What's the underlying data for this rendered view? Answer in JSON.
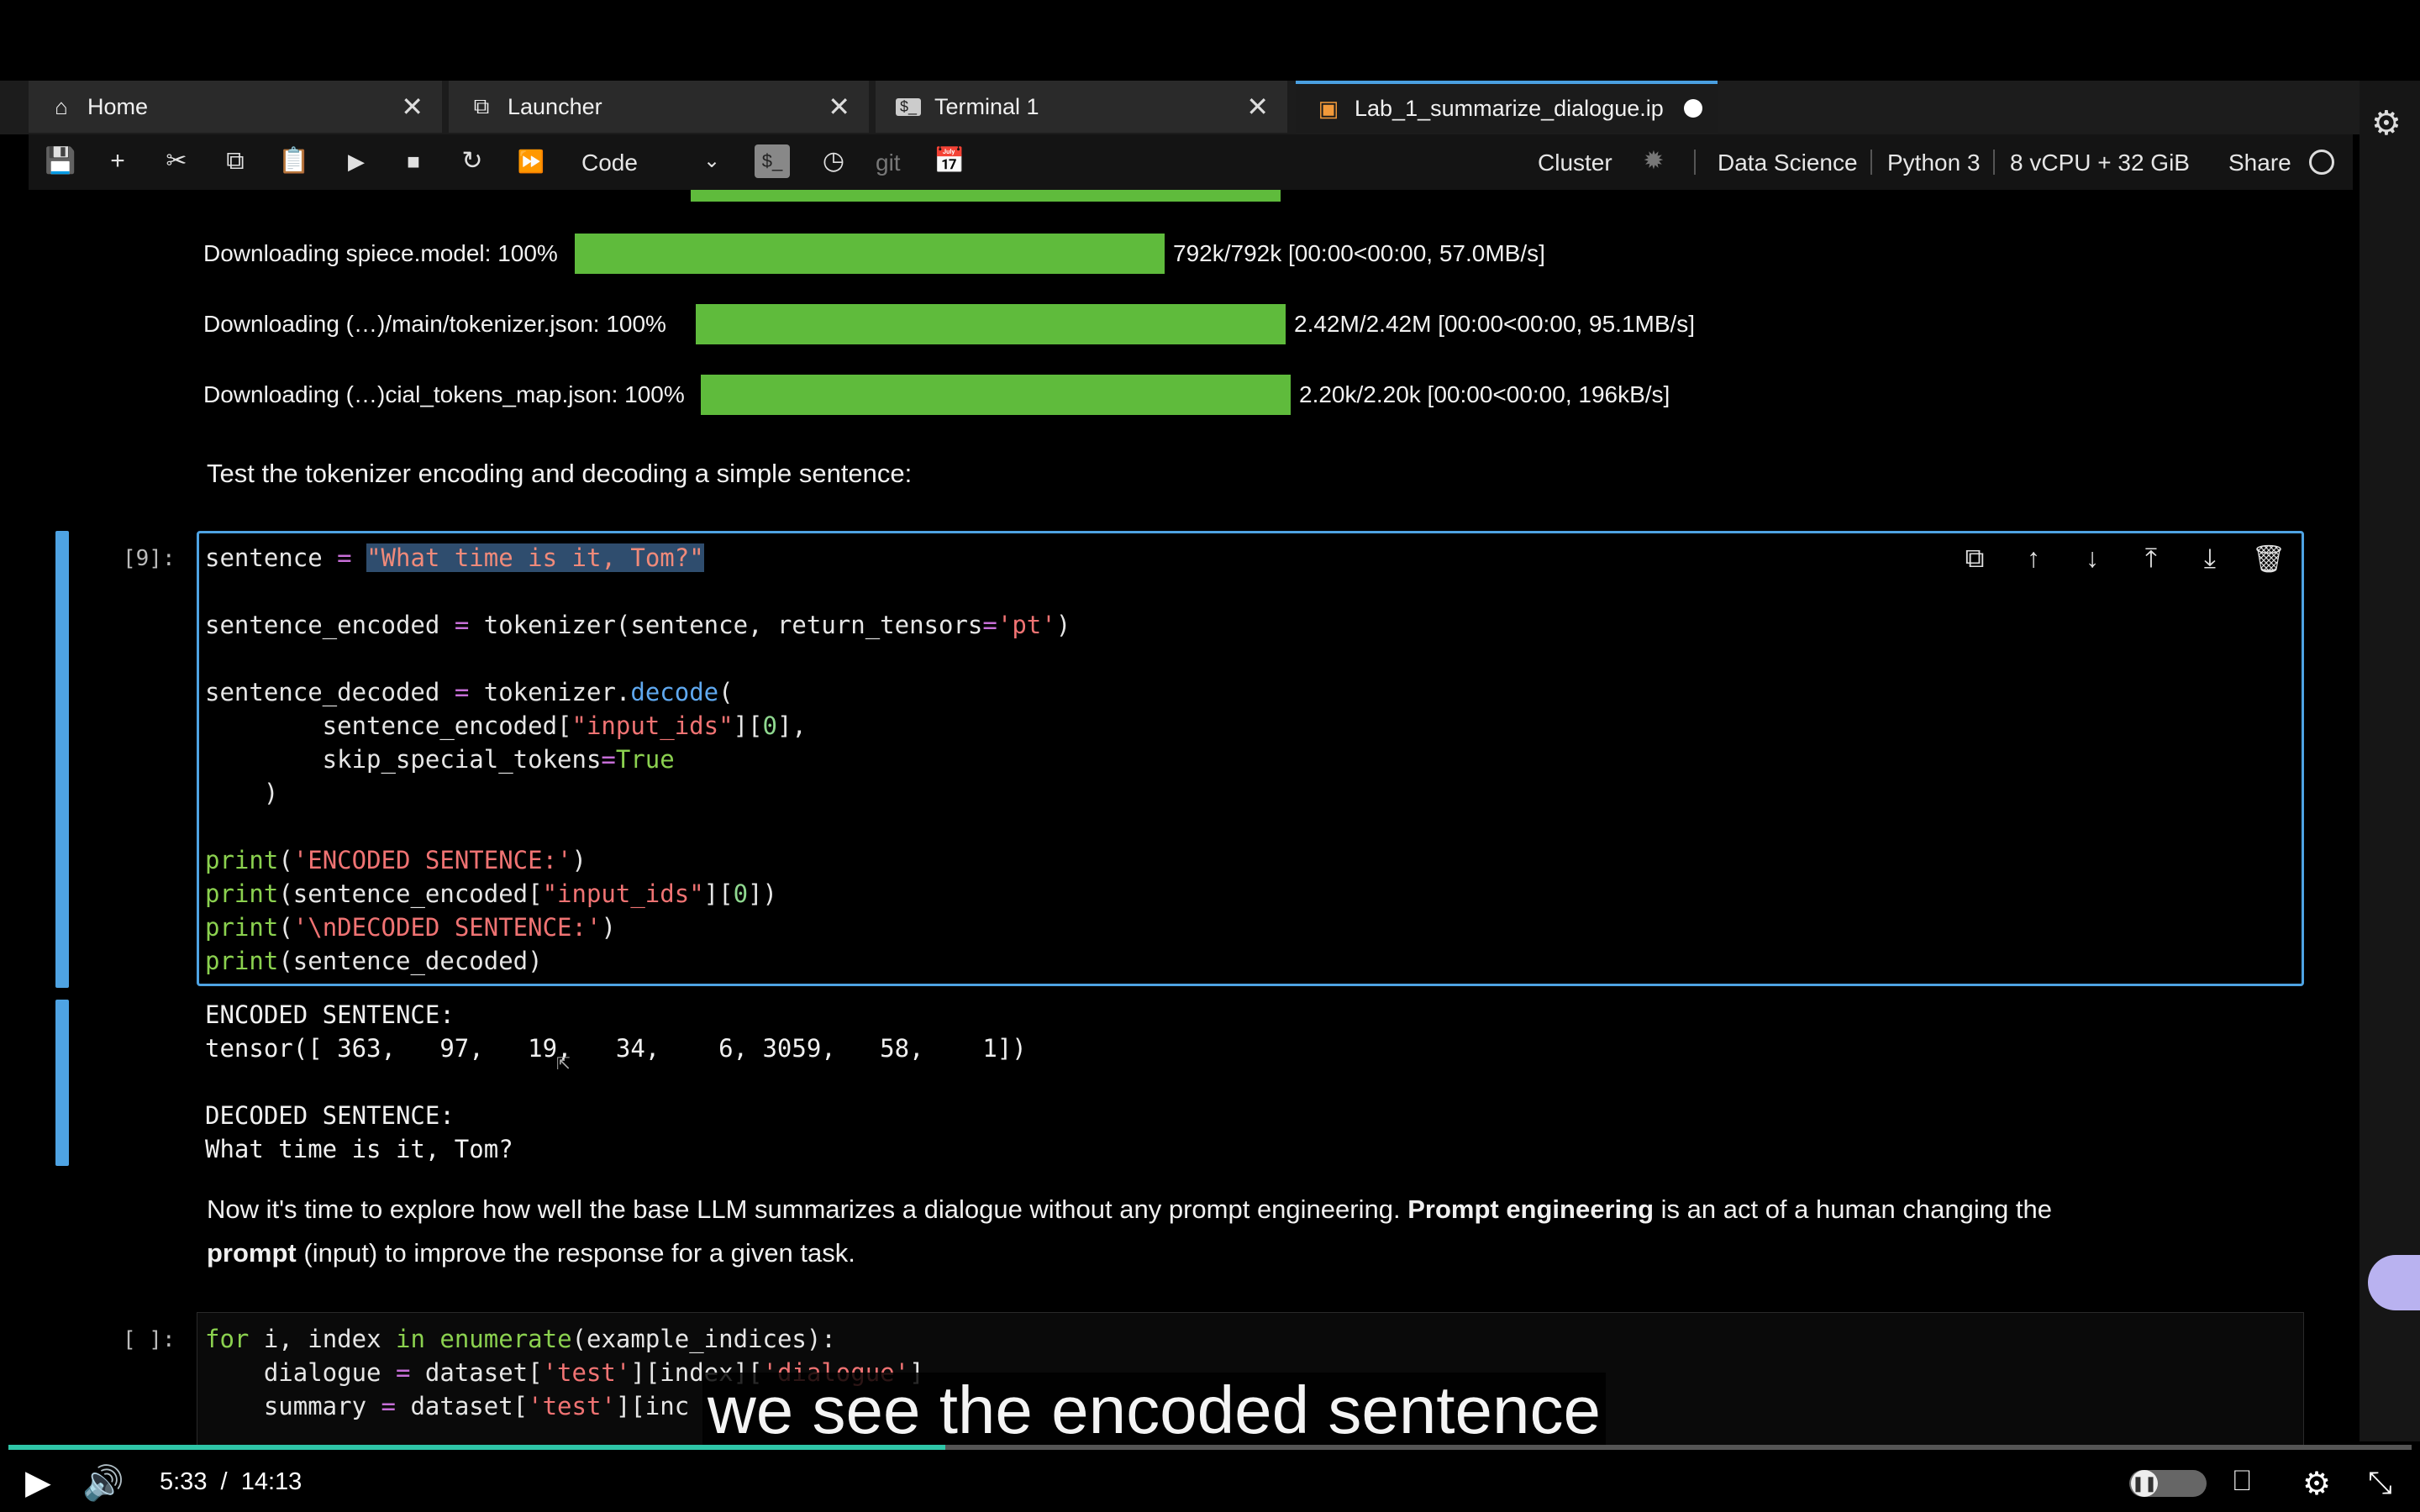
{
  "tabs": [
    {
      "label": "Home",
      "icon": "home-icon"
    },
    {
      "label": "Launcher",
      "icon": "external-link-icon"
    },
    {
      "label": "Terminal 1",
      "icon": "terminal-icon"
    },
    {
      "label": "Lab_1_summarize_dialogue.ip",
      "icon": "notebook-icon"
    }
  ],
  "toolbar": {
    "cell_type": "Code",
    "git_label": "git",
    "cluster_label": "Cluster",
    "image_label": "Data Science",
    "kernel_label": "Python 3",
    "instance_label": "8 vCPU + 32 GiB",
    "share_label": "Share"
  },
  "downloads": [
    {
      "label": "Downloading spiece.model: 100%",
      "progress": 1.0,
      "stats": "792k/792k [00:00<00:00, 57.0MB/s]"
    },
    {
      "label": "Downloading (…)/main/tokenizer.json: 100%",
      "progress": 1.0,
      "stats": "2.42M/2.42M [00:00<00:00, 95.1MB/s]"
    },
    {
      "label": "Downloading (…)cial_tokens_map.json: 100%",
      "progress": 1.0,
      "stats": "2.20k/2.20k [00:00<00:00, 196kB/s]"
    }
  ],
  "markdown1": "Test the tokenizer encoding and decoding a simple sentence:",
  "cell9": {
    "prompt": "[9]:",
    "code": {
      "l1_var": "sentence",
      "l1_str": "\"What time is it, Tom?\"",
      "l3_var": "sentence_encoded",
      "l3_a": "tokenizer(sentence, return_tensors",
      "l3_str": "'pt'",
      "l5_var": "sentence_decoded",
      "l5_a": "tokenizer.",
      "l5_fn": "decode",
      "l6_a": "        sentence_encoded[",
      "l6_str": "\"input_ids\"",
      "l6_num": "0",
      "l7_a": "        skip_special_tokens",
      "l7_kw": "True",
      "l8": "    )",
      "print": "print",
      "l10_str": "'ENCODED SENTENCE:'",
      "l11_a": "(sentence_encoded[",
      "l11_str": "\"input_ids\"",
      "l11_num": "0",
      "l12_str": "'\\nDECODED SENTENCE:'",
      "l13_a": "(sentence_decoded)"
    },
    "output": {
      "encoded_header": "ENCODED SENTENCE:",
      "tensor": "tensor([ 363,   97,   19,   34,    6, 3059,   58,    1])",
      "decoded_header": "DECODED SENTENCE:",
      "decoded": "What time is it, Tom?"
    }
  },
  "markdown2": {
    "p1": "Now it's time to explore how well the base LLM summarizes a dialogue without any prompt engineering. ",
    "b1": "Prompt engineering",
    "p2": " is an act of a human changing the",
    "b2": "prompt",
    "p3": " (input) to improve the response for a given task."
  },
  "cell_next": {
    "prompt": "[ ]:",
    "l1_kw": "for",
    "l1_a": " i, index ",
    "l1_kw2": "in",
    "l1_fn": "enumerate",
    "l1_b": "(example_indices):",
    "l2_a": "    dialogue ",
    "l2_b": " dataset[",
    "l2_str": "'test'",
    "l2_c": "][index][",
    "l2_str2": "'dialogue'",
    "l3_a": "    summary ",
    "l3_b": " dataset[",
    "l3_str": "'test'",
    "l3_c": "][inc"
  },
  "subtitle": "we see the encoded sentence",
  "video": {
    "time": "5:33  /  14:13",
    "progress": 0.39
  }
}
